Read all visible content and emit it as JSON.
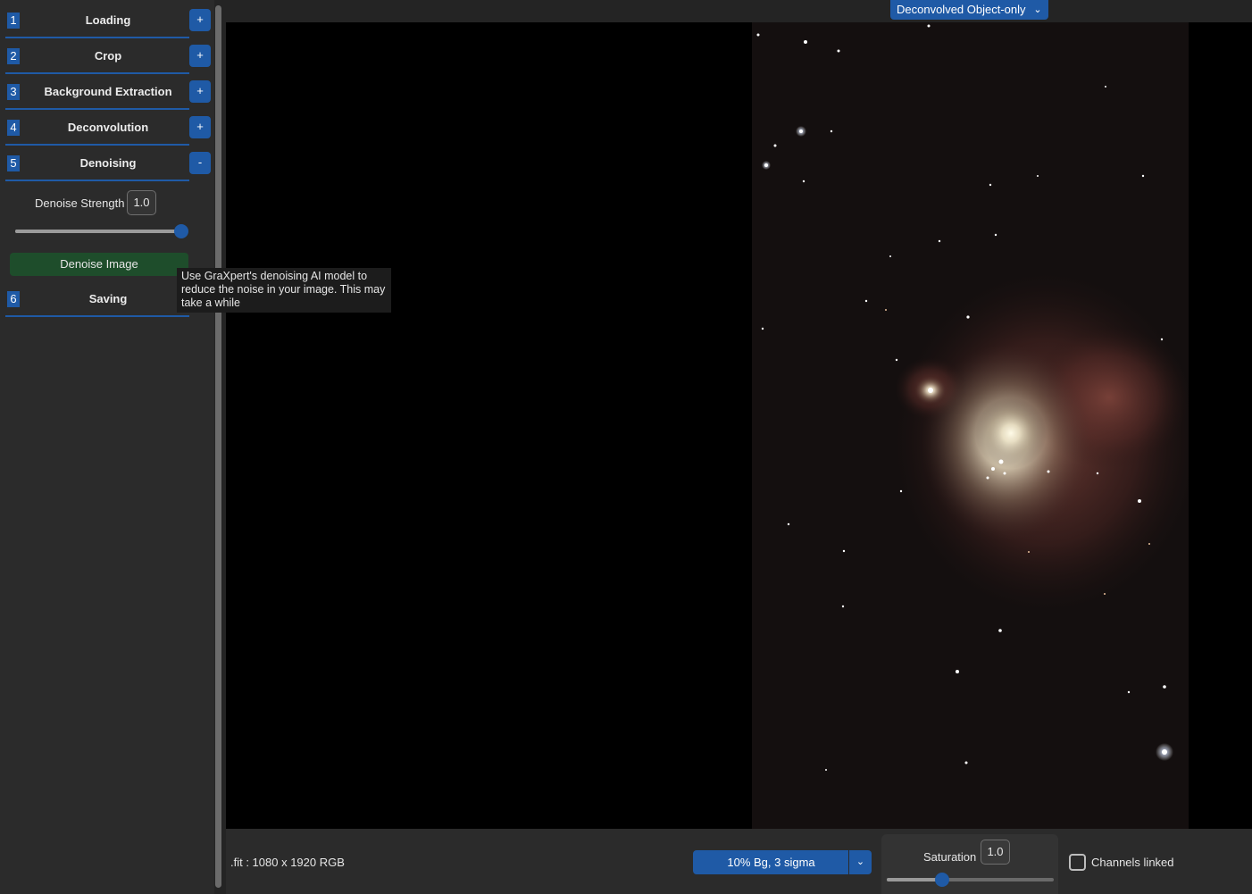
{
  "sidebar": {
    "sections": [
      {
        "number": "1",
        "title": "Loading",
        "toggle": "+"
      },
      {
        "number": "2",
        "title": "Crop",
        "toggle": "+"
      },
      {
        "number": "3",
        "title": "Background Extraction",
        "toggle": "+"
      },
      {
        "number": "4",
        "title": "Deconvolution",
        "toggle": "+"
      },
      {
        "number": "5",
        "title": "Denoising",
        "toggle": "-"
      },
      {
        "number": "6",
        "title": "Saving",
        "toggle": ""
      }
    ],
    "denoise": {
      "strength_label": "Denoise Strength",
      "strength_value": "1.0",
      "strength_fraction": 1.0,
      "button_label": "Denoise Image"
    }
  },
  "tooltip": {
    "text": "Use GraXpert's denoising AI model to reduce the noise in your image. This may take a while"
  },
  "topbar": {
    "display_mode": "Deconvolved Object-only"
  },
  "bottombar": {
    "file_info": ".fit : 1080 x 1920 RGB",
    "stretch_option": "10% Bg, 3 sigma",
    "saturation_label": "Saturation",
    "saturation_value": "1.0",
    "saturation_fraction": 0.33,
    "channels_linked_label": "Channels linked",
    "channels_linked": false
  },
  "colors": {
    "accent": "#1f5aa6",
    "action_green": "#1e4d2b",
    "panel": "#2b2b2b",
    "background": "#242424"
  }
}
